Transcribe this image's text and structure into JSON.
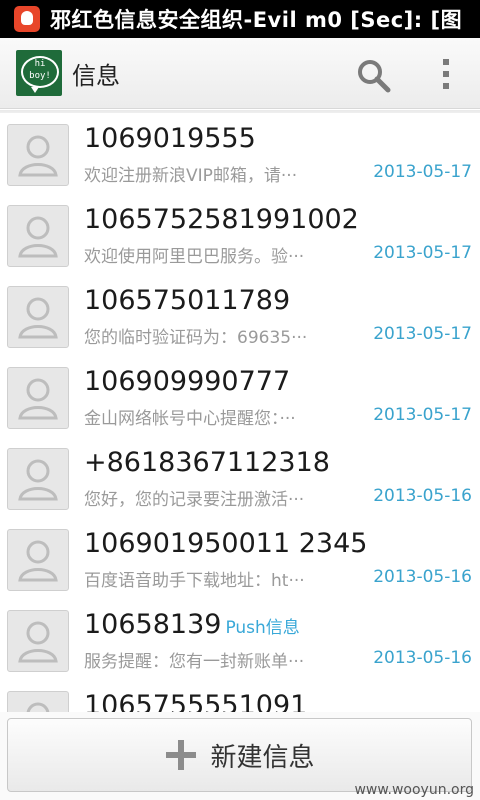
{
  "status_bar": {
    "title": "邪红色信息安全组织-Evil m0 [Sec]: [图"
  },
  "action_bar": {
    "logo_text_line1": "hi",
    "logo_text_line2": "boy!",
    "title": "信息",
    "icons": [
      "search-icon",
      "overflow-menu-icon"
    ]
  },
  "messages": [
    {
      "sender": "1069019555",
      "badge": "",
      "preview": "欢迎注册新浪VIP邮箱，请···",
      "date": "2013-05-17"
    },
    {
      "sender": "1065752581991002",
      "badge": "",
      "preview": "欢迎使用阿里巴巴服务。验···",
      "date": "2013-05-17"
    },
    {
      "sender": "106575011789",
      "badge": "",
      "preview": "您的临时验证码为：69635···",
      "date": "2013-05-17"
    },
    {
      "sender": "106909990777",
      "badge": "",
      "preview": "金山网络帐号中心提醒您：···",
      "date": "2013-05-17"
    },
    {
      "sender": "+8618367112318",
      "badge": "",
      "preview": "您好，您的记录要注册激活···",
      "date": "2013-05-16"
    },
    {
      "sender": "106901950011 2345",
      "badge": "",
      "preview": "百度语音助手下载地址：ht···",
      "date": "2013-05-16"
    },
    {
      "sender": "10658139",
      "badge": "Push信息",
      "preview": "服务提醒：您有一封新账单···",
      "date": "2013-05-16"
    },
    {
      "sender": "1065755551091",
      "badge": "",
      "preview": "",
      "date": ""
    }
  ],
  "bottom": {
    "new_message_label": "新建信息"
  },
  "watermark": "www.wooyun.org",
  "colors": {
    "accent": "#38a8d8",
    "status_bar": "#000000",
    "logo_bg": "#1f6b3a"
  }
}
